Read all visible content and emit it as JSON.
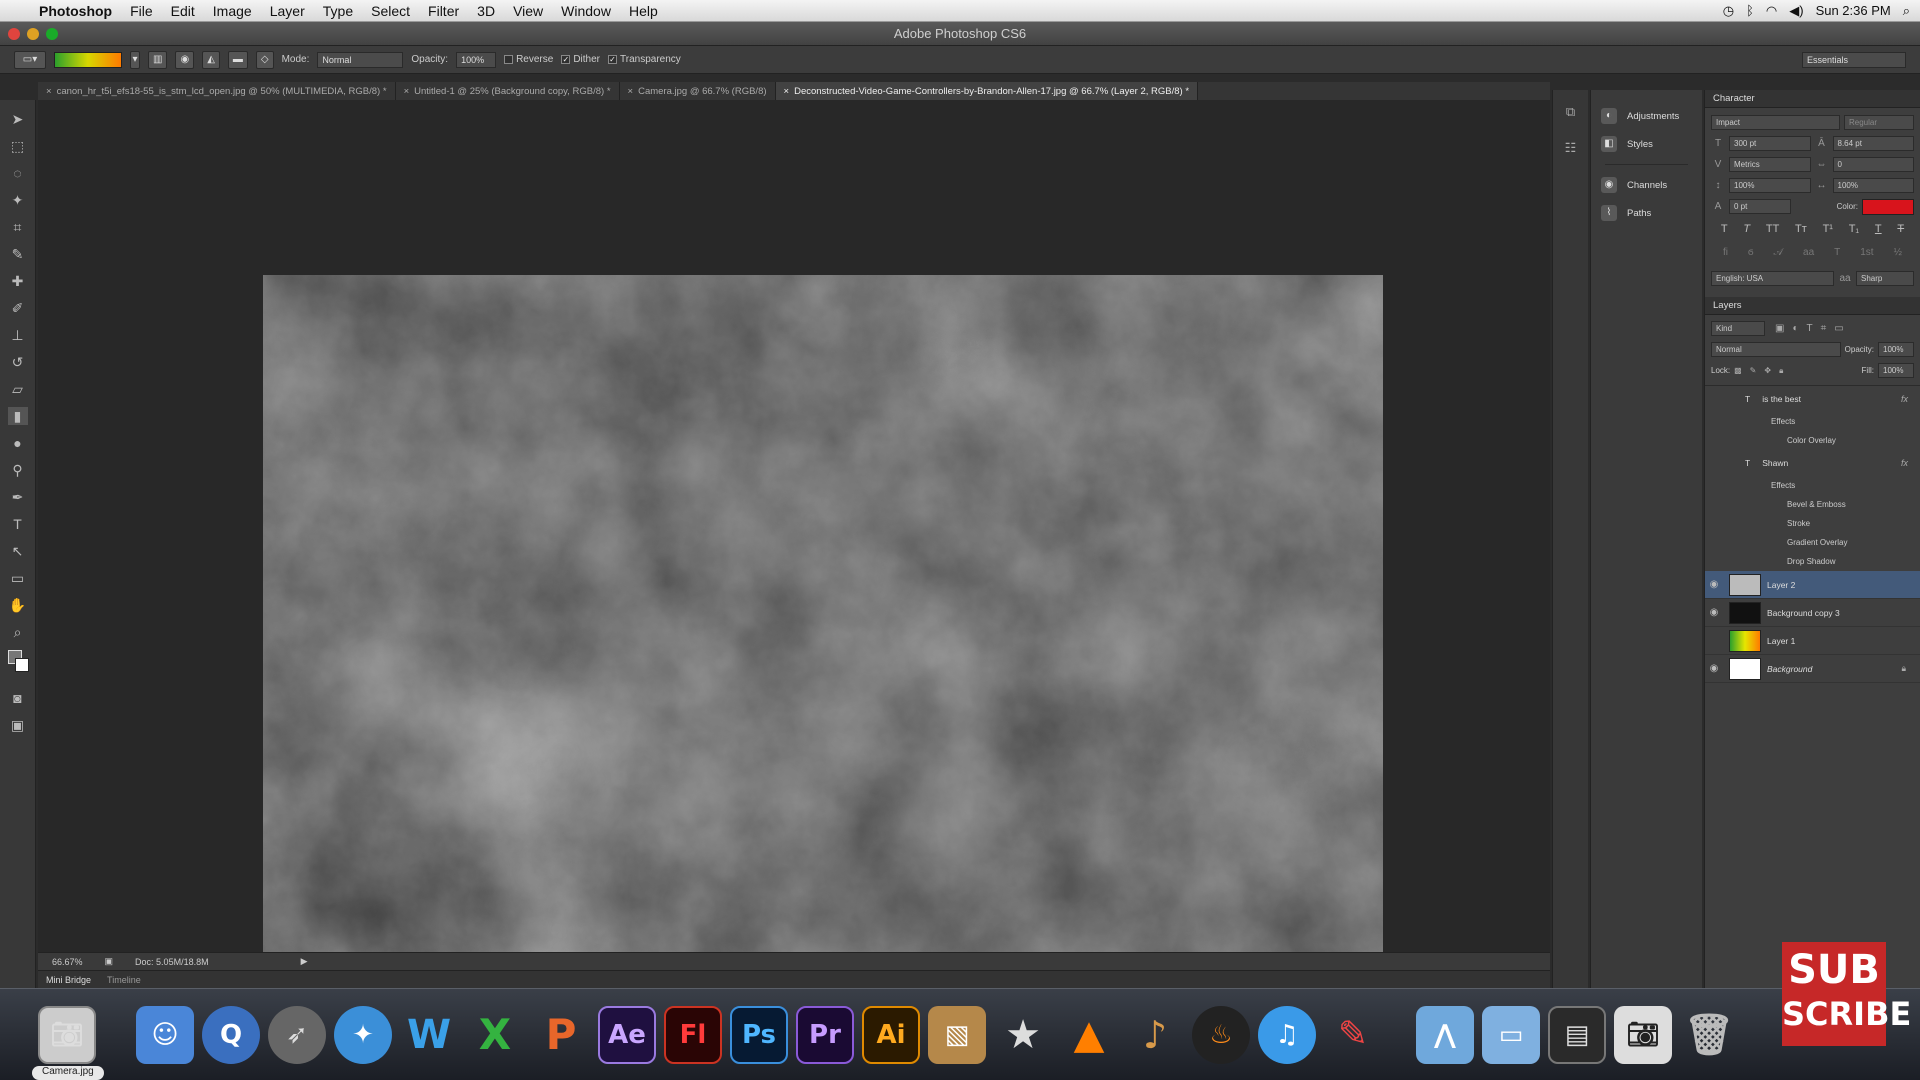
{
  "menubar": {
    "app": "Photoshop",
    "items": [
      "File",
      "Edit",
      "Image",
      "Layer",
      "Type",
      "Select",
      "Filter",
      "3D",
      "View",
      "Window",
      "Help"
    ],
    "clock": "Sun 2:36 PM"
  },
  "window": {
    "title": "Adobe Photoshop CS6"
  },
  "options": {
    "mode_label": "Mode:",
    "mode_value": "Normal",
    "opacity_label": "Opacity:",
    "opacity_value": "100%",
    "reverse": "Reverse",
    "dither": "Dither",
    "transparency": "Transparency",
    "workspace": "Essentials"
  },
  "tabs": [
    "canon_hr_t5i_efs18-55_is_stm_lcd_open.jpg @ 50% (MULTIMEDIA, RGB/8) *",
    "Untitled-1 @ 25% (Background copy, RGB/8) *",
    "Camera.jpg @ 66.7% (RGB/8)",
    "Deconstructed-Video-Game-Controllers-by-Brandon-Allen-17.jpg @ 66.7% (Layer 2, RGB/8) *"
  ],
  "status": {
    "zoom": "66.67%",
    "doc": "Doc: 5.05M/18.8M"
  },
  "minibridge": {
    "tab1": "Mini Bridge",
    "tab2": "Timeline"
  },
  "side_panels": [
    "Adjustments",
    "Styles",
    "Channels",
    "Paths"
  ],
  "character": {
    "title": "Character",
    "font": "Impact",
    "style": "Regular",
    "size": "300 pt",
    "leading": "8.64 pt",
    "kerning": "Metrics",
    "tracking": "0",
    "vscale": "100%",
    "hscale": "100%",
    "baseline": "0 pt",
    "color_label": "Color:",
    "color": "#d8141c",
    "language": "English: USA",
    "aa_icon": "aa",
    "aa": "Sharp"
  },
  "layers": {
    "title": "Layers",
    "kind": "Kind",
    "blend": "Normal",
    "opacity_label": "Opacity:",
    "opacity": "100%",
    "lock_label": "Lock:",
    "fill_label": "Fill:",
    "fill": "100%",
    "text1": "is the best",
    "effects": "Effects",
    "color_overlay": "Color Overlay",
    "text2": "Shawn",
    "bevel": "Bevel & Emboss",
    "stroke": "Stroke",
    "gradient_overlay": "Gradient Overlay",
    "drop_shadow": "Drop Shadow",
    "layer2": "Layer 2",
    "bgcopy": "Background copy 3",
    "layer1": "Layer 1",
    "background": "Background"
  },
  "dock": {
    "ae": "Ae",
    "fl": "Fl",
    "ps": "Ps",
    "pr": "Pr",
    "ai": "Ai",
    "tooltip": "Camera.jpg"
  },
  "overlay": {
    "line1": "SUB",
    "line2": "SCRIBE"
  }
}
